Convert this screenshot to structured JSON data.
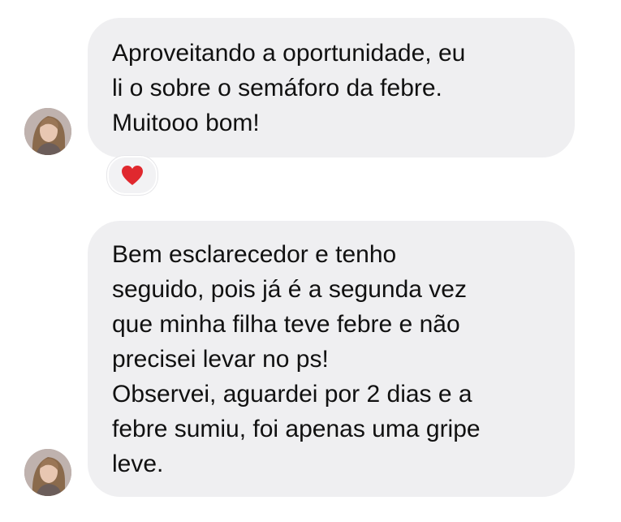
{
  "messages": [
    {
      "text": "Aproveitando a oportunidade, eu\nli o sobre o semáforo da febre.\nMuitooo bom!",
      "reaction": "heart-icon"
    },
    {
      "text": "Bem esclarecedor e tenho\nseguido, pois já é a segunda vez\nque minha filha teve febre e não\nprecisei levar no ps!\nObservei, aguardei por 2 dias e a\nfebre sumiu, foi apenas uma gripe\nleve."
    }
  ],
  "colors": {
    "bubble": "#efeff1",
    "text": "#111111",
    "heart": "#e0282e"
  }
}
